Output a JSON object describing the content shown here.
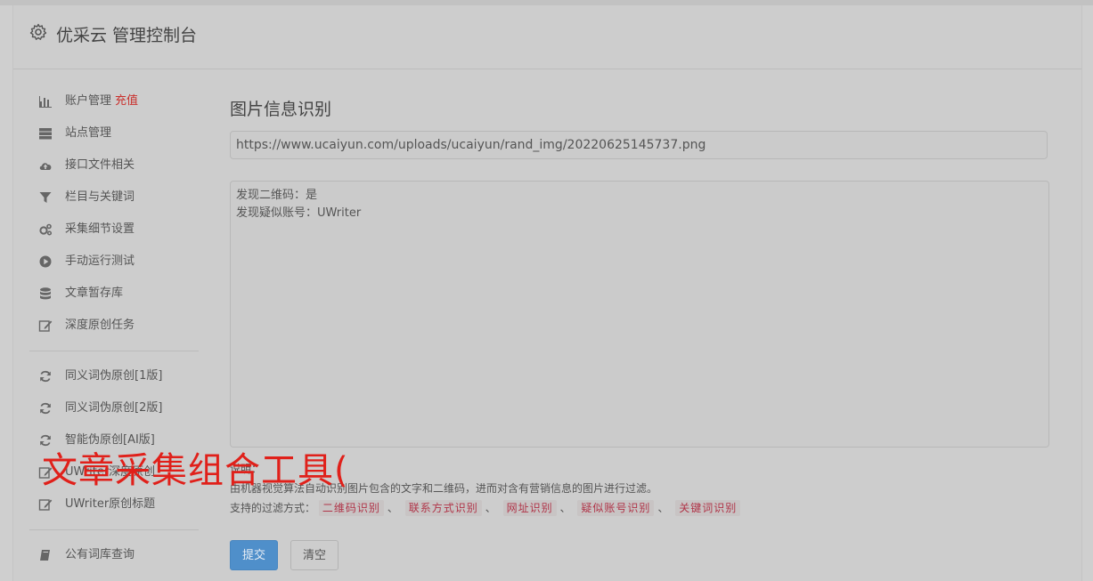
{
  "header": {
    "title": "优采云 管理控制台"
  },
  "sidebar": {
    "group1": [
      {
        "label": "账户管理",
        "extra": "充值",
        "icon": "bar-chart-icon"
      },
      {
        "label": "站点管理",
        "icon": "server-icon"
      },
      {
        "label": "接口文件相关",
        "icon": "cloud-upload-icon"
      },
      {
        "label": "栏目与关键词",
        "icon": "filter-icon"
      },
      {
        "label": "采集细节设置",
        "icon": "cogs-icon"
      },
      {
        "label": "手动运行测试",
        "icon": "play-circle-icon"
      },
      {
        "label": "文章暂存库",
        "icon": "database-icon"
      },
      {
        "label": "深度原创任务",
        "icon": "edit-icon"
      }
    ],
    "group2": [
      {
        "label": "同义词伪原创[1版]",
        "icon": "refresh-icon"
      },
      {
        "label": "同义词伪原创[2版]",
        "icon": "refresh-icon"
      },
      {
        "label": "智能伪原创[AI版]",
        "icon": "refresh-icon"
      },
      {
        "label": "UWriter深度原创",
        "icon": "edit-icon"
      },
      {
        "label": "UWriter原创标题",
        "icon": "edit-icon"
      }
    ],
    "group3": [
      {
        "label": "公有词库查询",
        "icon": "book-icon"
      }
    ]
  },
  "main": {
    "title": "图片信息识别",
    "url_value": "https://www.ucaiyun.com/uploads/ucaiyun/rand_img/20220625145737.png",
    "result_lines": [
      "发现二维码：是",
      "发现疑似账号：UWriter"
    ],
    "desc_label": "说明：",
    "desc_text": "由机器视觉算法自动识别图片包含的文字和二维码，进而对含有营销信息的图片进行过滤。",
    "filter_prefix": "支持的过滤方式：",
    "filters": [
      "二维码识别",
      "联系方式识别",
      "网址识别",
      "疑似账号识别",
      "关键词识别"
    ],
    "separator": "、",
    "submit_label": "提交",
    "clear_label": "清空"
  },
  "watermark": "文章采集组合工具(",
  "colors": {
    "accent": "#4f8fca",
    "danger": "#c9302c",
    "tag_text": "#b03448",
    "watermark": "#e0201a"
  }
}
